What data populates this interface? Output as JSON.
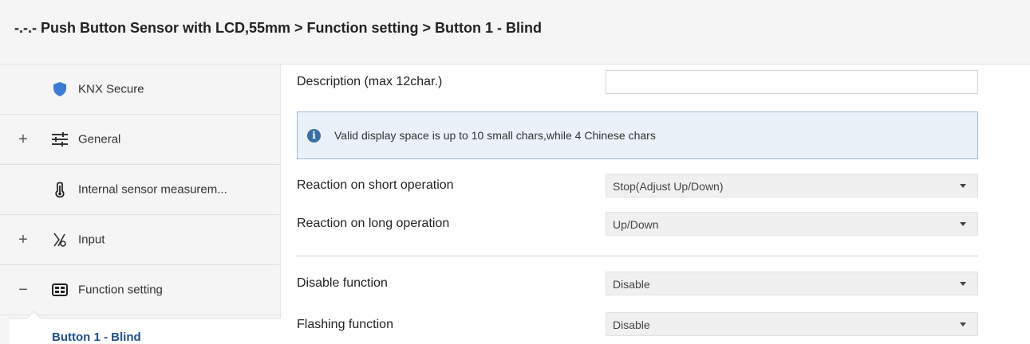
{
  "header": {
    "title": "-.-.- Push Button Sensor with LCD,55mm > Function setting > Button 1 - Blind"
  },
  "sidebar": {
    "items": [
      {
        "toggle": "",
        "icon": "shield-icon",
        "label": "KNX Secure"
      },
      {
        "toggle": "+",
        "icon": "sliders-icon",
        "label": "General"
      },
      {
        "toggle": "",
        "icon": "thermometer-icon",
        "label": "Internal sensor measurem..."
      },
      {
        "toggle": "+",
        "icon": "input-icon",
        "label": "Input"
      },
      {
        "toggle": "−",
        "icon": "grid-icon",
        "label": "Function setting"
      }
    ],
    "sub_item": {
      "label": "Button 1 - Blind"
    }
  },
  "main": {
    "description": {
      "label": "Description (max 12char.)",
      "value": "",
      "placeholder": ""
    },
    "info": {
      "text": "Valid display space is up to 10 small chars,while 4 Chinese chars"
    },
    "short_operation": {
      "label": "Reaction on short operation",
      "value": "Stop(Adjust Up/Down)"
    },
    "long_operation": {
      "label": "Reaction on long operation",
      "value": "Up/Down"
    },
    "disable_function": {
      "label": "Disable function",
      "value": "Disable"
    },
    "flashing_function": {
      "label": "Flashing function",
      "value": "Disable"
    }
  },
  "colors": {
    "accent": "#1f4f8f",
    "shield": "#3a7bd5",
    "info_border": "#9cbcd8",
    "info_bg": "#eaf1f8"
  }
}
